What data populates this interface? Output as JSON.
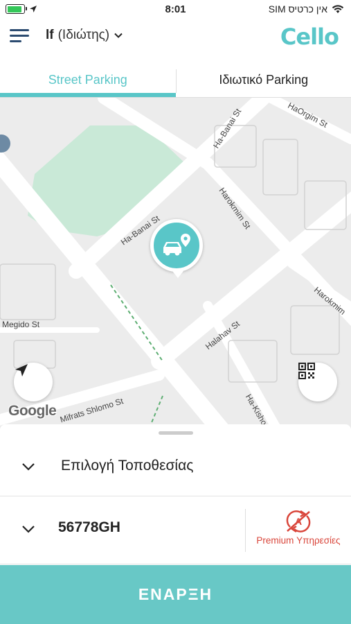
{
  "status_bar": {
    "time": "8:01",
    "carrier": "אין כרטיס SIM",
    "battery_level": 0.85,
    "battery_color": "#34c759",
    "icons": [
      "battery-charging-icon",
      "location-arrow-icon",
      "wifi-icon"
    ]
  },
  "header": {
    "account_name": "lf",
    "account_type": "(Ιδιώτης)",
    "logo_text": "Cello",
    "accent_color": "#59c6c8",
    "menu_color": "#2b4b70"
  },
  "tabs": [
    {
      "label": "Street Parking",
      "active": true
    },
    {
      "label": "Ιδιωτικό Parking",
      "active": false
    }
  ],
  "map": {
    "streets": {
      "ha_banai_top": "Ha-Banai St",
      "haorgim": "HaOrgim St",
      "ha_banai_mid": "Ha-Banai St",
      "harokmim": "Harokmim St",
      "harokmim_right": "Harokmim",
      "megido": "Megido St",
      "halahav": "Halahav St",
      "mifrats": "Mifrats Shlomo St",
      "ha_kishon": "Ha-Kishon"
    },
    "google_logo": "Google",
    "park_color": "#c9e9d7"
  },
  "sheet": {
    "location_label": "Επιλογή Τοποθεσίας",
    "vehicle_plate": "56778GH",
    "premium_label": "Premium Υπηρεσίες",
    "premium_color": "#d9453a"
  },
  "start_button": {
    "label": "ΕΝΑΡΞΗ",
    "color": "#68c8c6"
  }
}
